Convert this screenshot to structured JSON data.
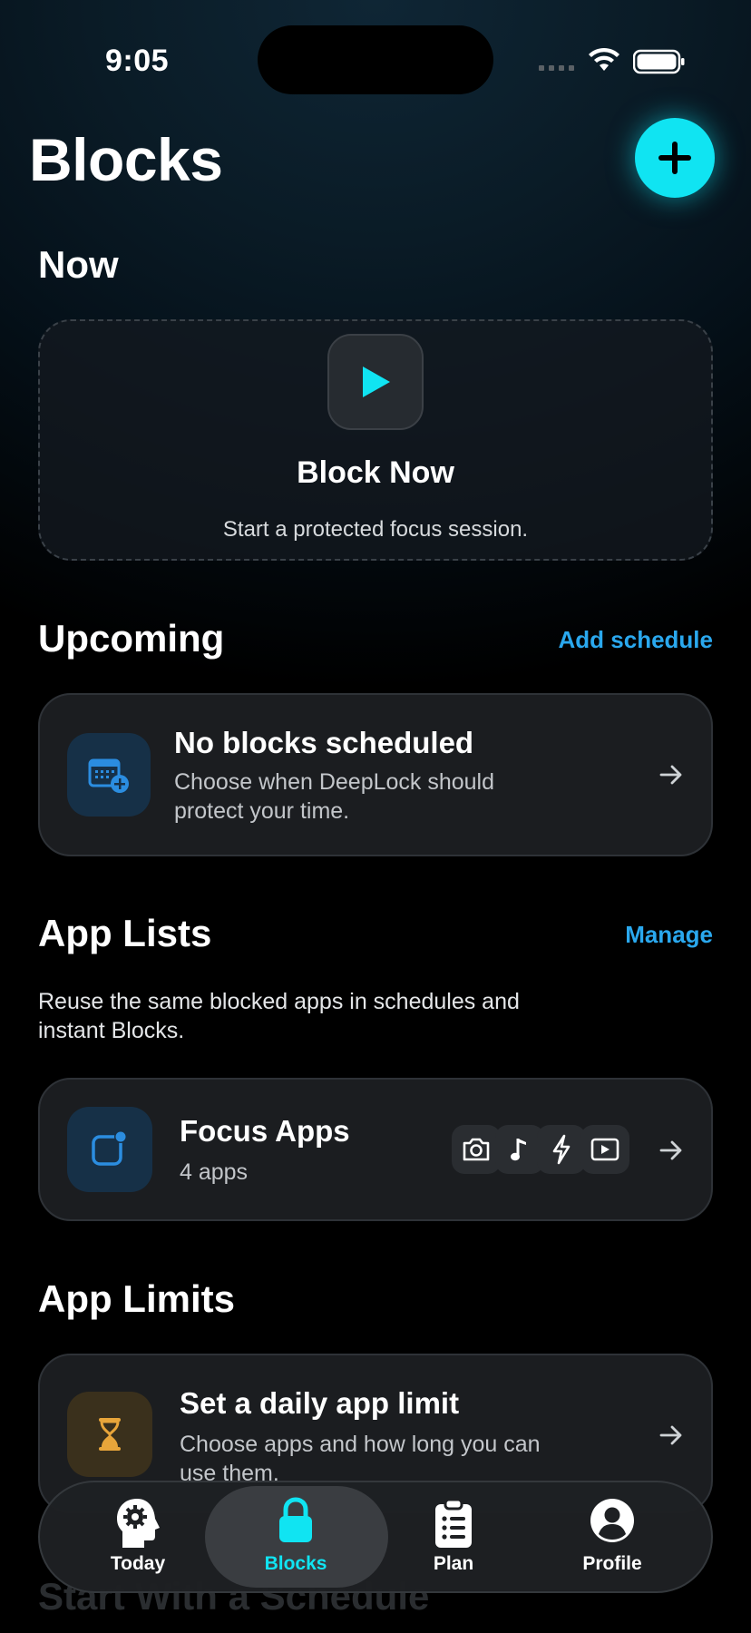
{
  "status_bar": {
    "time": "9:05"
  },
  "header": {
    "title": "Blocks"
  },
  "now": {
    "section_title": "Now",
    "card_title": "Block Now",
    "card_subtitle": "Start a protected focus session."
  },
  "upcoming": {
    "section_title": "Upcoming",
    "link": "Add schedule",
    "card_title": "No blocks scheduled",
    "card_subtitle_line1": "Choose when DeepLock should",
    "card_subtitle_line2": "protect your time."
  },
  "app_lists": {
    "section_title": "App Lists",
    "link": "Manage",
    "description_line1": "Reuse the same blocked apps in schedules and",
    "description_line2": "instant Blocks.",
    "list": {
      "title": "Focus Apps",
      "count": "4 apps",
      "app_icons": [
        "camera-icon",
        "music-note-icon",
        "bolt-icon",
        "play-icon"
      ]
    }
  },
  "app_limits": {
    "section_title": "App Limits",
    "card_title": "Set a daily app limit",
    "card_subtitle_line1": "Choose apps and how long you can",
    "card_subtitle_line2": "use them."
  },
  "next_section": {
    "title": "Start With a Schedule"
  },
  "tabs": [
    {
      "label": "Today",
      "icon": "head-gear-icon",
      "active": false
    },
    {
      "label": "Blocks",
      "icon": "lock-icon",
      "active": true
    },
    {
      "label": "Plan",
      "icon": "clipboard-list-icon",
      "active": false
    },
    {
      "label": "Profile",
      "icon": "person-circle-icon",
      "active": false
    }
  ],
  "colors": {
    "accent": "#10e4f2",
    "link": "#2aa8ee",
    "amber": "#e8a53a",
    "blue": "#2b8de0"
  }
}
